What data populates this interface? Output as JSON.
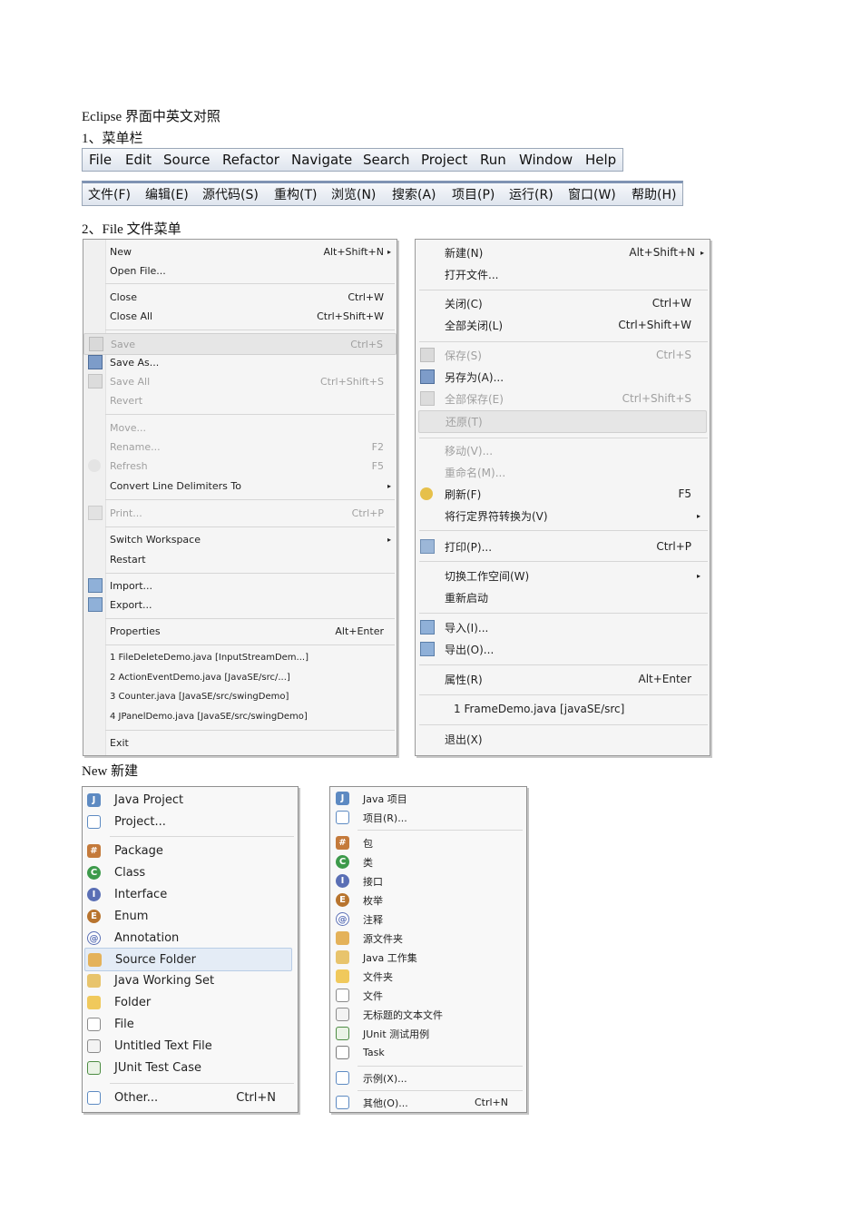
{
  "heading": {
    "title": "Eclipse  界面中英文对照",
    "sec1": "1、菜单栏",
    "sec2": "2、File    文件菜单",
    "sec3": "New  新建"
  },
  "menubar_en": [
    "File",
    "Edit",
    "Source",
    "Refactor",
    "Navigate",
    "Search",
    "Project",
    "Run",
    "Window",
    "Help"
  ],
  "menubar_cn": [
    "文件(F)",
    "编辑(E)",
    "源代码(S)",
    "重构(T)",
    "浏览(N)",
    "搜索(A)",
    "项目(P)",
    "运行(R)",
    "窗口(W)",
    "帮助(H)"
  ],
  "file_en": {
    "items": [
      {
        "label": "New",
        "acc": "Alt+Shift+N",
        "arrow": "▸"
      },
      {
        "label": "Open File..."
      },
      {
        "label": "Close",
        "acc": "Ctrl+W"
      },
      {
        "label": "Close All",
        "acc": "Ctrl+Shift+W"
      },
      {
        "label": "Save",
        "acc": "Ctrl+S"
      },
      {
        "label": "Save As..."
      },
      {
        "label": "Save All",
        "acc": "Ctrl+Shift+S"
      },
      {
        "label": "Revert"
      },
      {
        "label": "Move..."
      },
      {
        "label": "Rename...",
        "acc": "F2"
      },
      {
        "label": "Refresh",
        "acc": "F5"
      },
      {
        "label": "Convert Line Delimiters To",
        "arrow": "▸"
      },
      {
        "label": "Print...",
        "acc": "Ctrl+P"
      },
      {
        "label": "Switch Workspace",
        "arrow": "▸"
      },
      {
        "label": "Restart"
      },
      {
        "label": "Import..."
      },
      {
        "label": "Export..."
      },
      {
        "label": "Properties",
        "acc": "Alt+Enter"
      },
      {
        "label": "1 FileDeleteDemo.java  [InputStreamDem...]"
      },
      {
        "label": "2 ActionEventDemo.java  [JavaSE/src/...]"
      },
      {
        "label": "3 Counter.java  [JavaSE/src/swingDemo]"
      },
      {
        "label": "4 JPanelDemo.java  [JavaSE/src/swingDemo]"
      },
      {
        "label": "Exit"
      }
    ]
  },
  "file_cn": {
    "items": [
      {
        "label": "新建(N)",
        "acc": "Alt+Shift+N",
        "arrow": "▸"
      },
      {
        "label": "打开文件..."
      },
      {
        "label": "关闭(C)",
        "acc": "Ctrl+W"
      },
      {
        "label": "全部关闭(L)",
        "acc": "Ctrl+Shift+W"
      },
      {
        "label": "保存(S)",
        "acc": "Ctrl+S"
      },
      {
        "label": "另存为(A)..."
      },
      {
        "label": "全部保存(E)",
        "acc": "Ctrl+Shift+S"
      },
      {
        "label": "还原(T)"
      },
      {
        "label": "移动(V)..."
      },
      {
        "label": "重命名(M)..."
      },
      {
        "label": "刷新(F)",
        "acc": "F5"
      },
      {
        "label": "将行定界符转换为(V)",
        "arrow": "▸"
      },
      {
        "label": "打印(P)...",
        "acc": "Ctrl+P"
      },
      {
        "label": "切换工作空间(W)",
        "arrow": "▸"
      },
      {
        "label": "重新启动"
      },
      {
        "label": "导入(I)..."
      },
      {
        "label": "导出(O)..."
      },
      {
        "label": "属性(R)",
        "acc": "Alt+Enter"
      },
      {
        "label": "1 FrameDemo.java  [javaSE/src]"
      },
      {
        "label": "退出(X)"
      }
    ]
  },
  "new_en": {
    "items": [
      {
        "label": "Java Project",
        "icon": "java-project-icon"
      },
      {
        "label": "Project...",
        "icon": "project-icon"
      },
      {
        "label": "Package",
        "icon": "package-icon"
      },
      {
        "label": "Class",
        "icon": "class-icon"
      },
      {
        "label": "Interface",
        "icon": "interface-icon"
      },
      {
        "label": "Enum",
        "icon": "enum-icon"
      },
      {
        "label": "Annotation",
        "icon": "annotation-icon"
      },
      {
        "label": "Source Folder",
        "icon": "source-folder-icon"
      },
      {
        "label": "Java Working Set",
        "icon": "working-set-icon"
      },
      {
        "label": "Folder",
        "icon": "folder-icon"
      },
      {
        "label": "File",
        "icon": "file-icon"
      },
      {
        "label": "Untitled Text File",
        "icon": "text-file-icon"
      },
      {
        "label": "JUnit Test Case",
        "icon": "junit-icon"
      },
      {
        "label": "Other...",
        "acc": "Ctrl+N",
        "icon": "other-icon"
      }
    ]
  },
  "new_cn": {
    "items": [
      {
        "label": "Java 项目",
        "icon": "java-project-icon"
      },
      {
        "label": "项目(R)...",
        "icon": "project-icon"
      },
      {
        "label": "包",
        "icon": "package-icon"
      },
      {
        "label": "类",
        "icon": "class-icon"
      },
      {
        "label": "接口",
        "icon": "interface-icon"
      },
      {
        "label": "枚举",
        "icon": "enum-icon"
      },
      {
        "label": "注释",
        "icon": "annotation-icon"
      },
      {
        "label": "源文件夹",
        "icon": "source-folder-icon"
      },
      {
        "label": "Java 工作集",
        "icon": "working-set-icon"
      },
      {
        "label": "文件夹",
        "icon": "folder-icon"
      },
      {
        "label": "文件",
        "icon": "file-icon"
      },
      {
        "label": "无标题的文本文件",
        "icon": "text-file-icon"
      },
      {
        "label": "JUnit 测试用例",
        "icon": "junit-icon"
      },
      {
        "label": "Task",
        "icon": "task-icon"
      },
      {
        "label": "示例(X)...",
        "icon": "example-icon"
      },
      {
        "label": "其他(O)...",
        "acc": "Ctrl+N",
        "icon": "other-icon"
      }
    ]
  }
}
